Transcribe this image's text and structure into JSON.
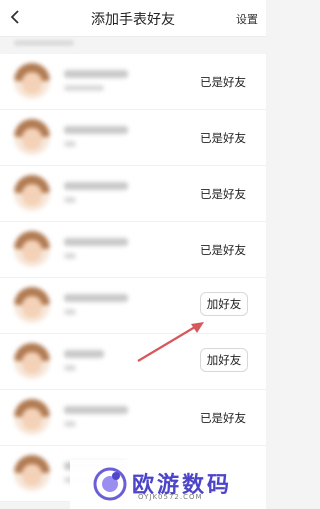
{
  "header": {
    "title": "添加手表好友",
    "settings_label": "设置"
  },
  "contacts": [
    {
      "status": "已是好友"
    },
    {
      "status": "已是好友"
    },
    {
      "status": "已是好友"
    },
    {
      "status": "已是好友"
    },
    {
      "action": "加好友"
    },
    {
      "action": "加好友"
    },
    {
      "status": "已是好友"
    },
    {
      "status": ""
    }
  ],
  "watermark": {
    "brand": "欧游数码",
    "url": "OYJK0572.COM"
  },
  "colors": {
    "arrow": "#d8575c",
    "brand": "#4c44c9"
  }
}
